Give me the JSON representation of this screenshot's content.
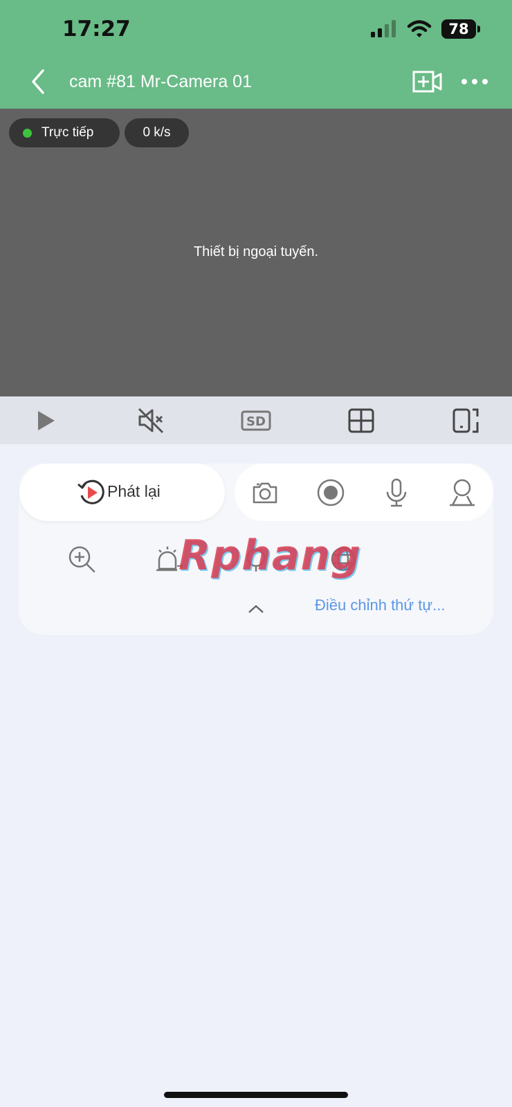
{
  "status_bar": {
    "time": "17:27",
    "battery": "78"
  },
  "header": {
    "title": "cam #81 Mr-Camera 01"
  },
  "video": {
    "live_label": "Trực tiếp",
    "bitrate": "0 k/s",
    "offline_message": "Thiết bị ngoại tuyến."
  },
  "controls": {
    "quality_label": "SD"
  },
  "panel": {
    "playback_label": "Phát lại",
    "watermark": "Rphang",
    "reorder_label": "Điều chỉnh thứ tự..."
  },
  "colors": {
    "header_green": "#69bb87",
    "link_blue": "#5b97e5",
    "live_dot": "#3fc33f"
  }
}
